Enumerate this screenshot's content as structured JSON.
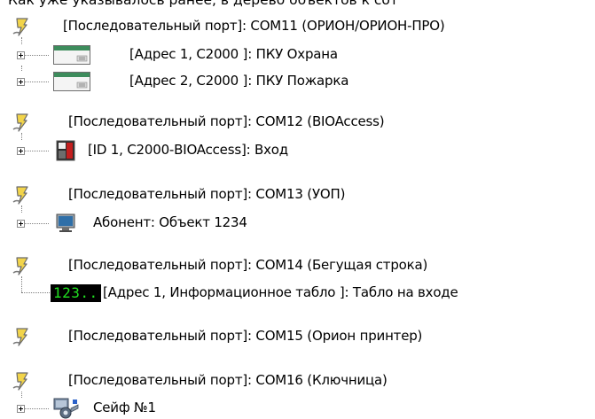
{
  "caption": "Как уже указывалось ранее, в дерево объектов к сот",
  "tree": [
    {
      "port": {
        "label": "[Последовательный порт]: COM11 (ОРИОН/ОРИОН-ПРО)",
        "icon": "serial-port-icon"
      },
      "children": [
        {
          "label": "[Адрес 1, С2000 ]: ПКУ Охрана",
          "icon": "c2000-controller-icon"
        },
        {
          "label": "[Адрес 2, С2000 ]: ПКУ Пожарка",
          "icon": "c2000-controller-icon"
        }
      ]
    },
    {
      "port": {
        "label": "[Последовательный порт]: COM12 (BIOAccess)",
        "icon": "serial-port-icon"
      },
      "children": [
        {
          "label": "[ID 1, С2000-BIOAccess]: Вход",
          "icon": "bioaccess-reader-icon"
        }
      ]
    },
    {
      "port": {
        "label": "[Последовательный порт]: COM13 (УОП)",
        "icon": "serial-port-icon"
      },
      "children": [
        {
          "label": "Абонент: Объект 1234",
          "icon": "monitor-icon"
        }
      ]
    },
    {
      "port": {
        "label": "[Последовательный порт]: COM14 (Бегущая строка)",
        "icon": "serial-port-icon"
      },
      "children": [
        {
          "label": "[Адрес 1, Информационное табло ]: Табло на входе",
          "icon": "led-display-icon",
          "display_text": "123.."
        }
      ]
    },
    {
      "port": {
        "label": "[Последовательный порт]: COM15 (Орион принтер)",
        "icon": "serial-port-icon"
      },
      "children": []
    },
    {
      "port": {
        "label": "[Последовательный порт]: COM16 (Ключница)",
        "icon": "serial-port-icon"
      },
      "children": [
        {
          "label": "Сейф №1",
          "icon": "key-safe-icon"
        }
      ]
    }
  ]
}
